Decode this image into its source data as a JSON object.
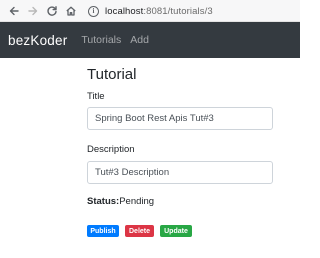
{
  "browser": {
    "url_host": "localhost",
    "url_path": ":8081/tutorials/3",
    "info_glyph": "i",
    "icons": [
      "back-arrow-icon",
      "forward-arrow-icon",
      "reload-icon",
      "home-icon",
      "info-icon"
    ]
  },
  "navbar": {
    "brand": "bezKoder",
    "links": [
      "Tutorials",
      "Add"
    ],
    "background": "#343a40"
  },
  "tutorial": {
    "heading": "Tutorial",
    "title_label": "Title",
    "title_value": "Spring Boot Rest Apis Tut#3",
    "description_label": "Description",
    "description_value": "Tut#3 Description",
    "status_label": "Status:",
    "status_value": "Pending"
  },
  "actions": {
    "publish": "Publish",
    "delete": "Delete",
    "update": "Update",
    "colors": {
      "publish": "#007bff",
      "delete": "#dc3545",
      "update": "#28a745"
    }
  }
}
